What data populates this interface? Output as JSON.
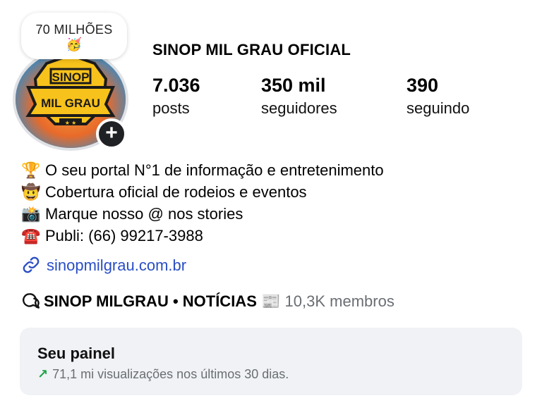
{
  "note": {
    "text": "70 MILHÕES",
    "emoji": "🥳"
  },
  "profile": {
    "username": "SINOP MIL GRAU OFICIAL",
    "avatar_text_top": "SINOP",
    "avatar_text_bottom": "MIL GRAU"
  },
  "stats": [
    {
      "value": "7.036",
      "label": "posts"
    },
    {
      "value": "350 mil",
      "label": "seguidores"
    },
    {
      "value": "390",
      "label": "seguindo"
    }
  ],
  "bio": [
    {
      "emoji": "🏆",
      "text": "O seu portal N°1 de informação e entretenimento"
    },
    {
      "emoji": "🤠",
      "text": "Cobertura oficial de rodeios e eventos"
    },
    {
      "emoji": "📸",
      "text": "Marque nosso @ nos stories"
    },
    {
      "emoji": "☎️",
      "text": "Publi: (66) 99217-3988"
    }
  ],
  "link": {
    "text": "sinopmilgrau.com.br"
  },
  "channel": {
    "name": "SINOP MILGRAU • NOTÍCIAS",
    "emoji": "📰",
    "members": "10,3K membros"
  },
  "panel": {
    "title": "Seu painel",
    "trend_icon": "↗",
    "subtitle": "71,1 mi visualizações nos últimos 30 dias."
  },
  "colors": {
    "link": "#2a4ec4",
    "trend": "#1ea446",
    "panel_bg": "#f0f2f5",
    "muted": "#6a6e73"
  }
}
